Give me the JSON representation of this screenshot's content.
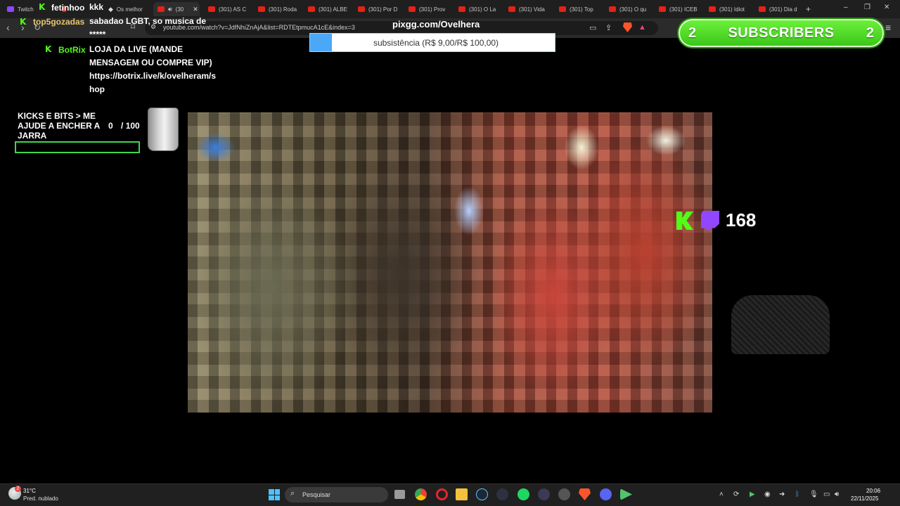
{
  "browser": {
    "tabs": [
      {
        "label": "Twitch",
        "kind": "twitch"
      },
      {
        "label": "",
        "kind": "youtube"
      },
      {
        "label": "Os melhor",
        "kind": "other"
      },
      {
        "label": "(30",
        "kind": "youtube",
        "active": true
      },
      {
        "label": "(301) AS C",
        "kind": "youtube"
      },
      {
        "label": "(301) Roda",
        "kind": "youtube"
      },
      {
        "label": "(301) ALBE",
        "kind": "youtube"
      },
      {
        "label": "(301) Por D",
        "kind": "youtube"
      },
      {
        "label": "(301) Prov",
        "kind": "youtube"
      },
      {
        "label": "(301) O La",
        "kind": "youtube"
      },
      {
        "label": "(301) Vida",
        "kind": "youtube"
      },
      {
        "label": "(301) Top",
        "kind": "youtube"
      },
      {
        "label": "(301) O qu",
        "kind": "youtube"
      },
      {
        "label": "(301) ICEB",
        "kind": "youtube"
      },
      {
        "label": "(301) Idiot",
        "kind": "youtube"
      },
      {
        "label": "(301) Dia d",
        "kind": "youtube"
      }
    ],
    "new_tab": "+",
    "url": "youtube.com/watch?v=JdfNhiZnAjA&list=RDTEtpmucA1cE&index=3",
    "icons": {
      "back": "arrow-left-icon",
      "forward": "arrow-right-icon",
      "reload": "reload-icon",
      "bookmark": "bookmark-icon",
      "cast": "cast-icon",
      "share": "share-icon",
      "brave": "brave-lion-icon",
      "rewards": "brave-rewards-icon",
      "menu": "hamburger-icon"
    },
    "window_controls": {
      "minimize": "–",
      "restore": "❐",
      "close": "✕"
    }
  },
  "overlay": {
    "chat": [
      {
        "user": "fetinhoo",
        "message": "kkk",
        "color": "#ffffff"
      },
      {
        "user": "top5gozadas",
        "message": "sabadao LGBT, so musica de *****",
        "color": "#e8c66f"
      },
      {
        "user": "BotRix",
        "message": "LOJA DA LIVE (MANDE MENSAGEM OU COMPRE VIP) https://botrix.live/k/ovelheram/shop",
        "color": "#53fc18"
      }
    ],
    "pix": {
      "title": "pixgg.com/Ovelhera",
      "goal_label": "subsistência (R$ 9,00/R$ 100,00)",
      "progress": 0.09,
      "bar_color": "#4aa8f7"
    },
    "subscribers": {
      "left_count": "2",
      "label": "SUBSCRIBERS",
      "right_count": "2",
      "color": "#4fd926"
    },
    "jar_goal": {
      "title": "KICKS E BITS > ME AJUDE A ENCHER A JARRA",
      "current": "0",
      "target": "/ 100",
      "progress": 0.0,
      "bar_color": "#3fd64a"
    },
    "viewers": {
      "count": "168",
      "kick_color": "#53fc18",
      "twitch_color": "#9146ff"
    }
  },
  "taskbar": {
    "weather": {
      "temp": "31°C",
      "desc": "Pred. nublado",
      "badge": "2"
    },
    "search_placeholder": "Pesquisar",
    "apps": [
      "task-view",
      "chrome",
      "opera",
      "file-explorer",
      "steam",
      "app",
      "spotify",
      "app-arrow",
      "app-gear",
      "brave",
      "discord",
      "app-green"
    ],
    "clock": {
      "time": "20:06",
      "date": "22/11/2025"
    }
  }
}
